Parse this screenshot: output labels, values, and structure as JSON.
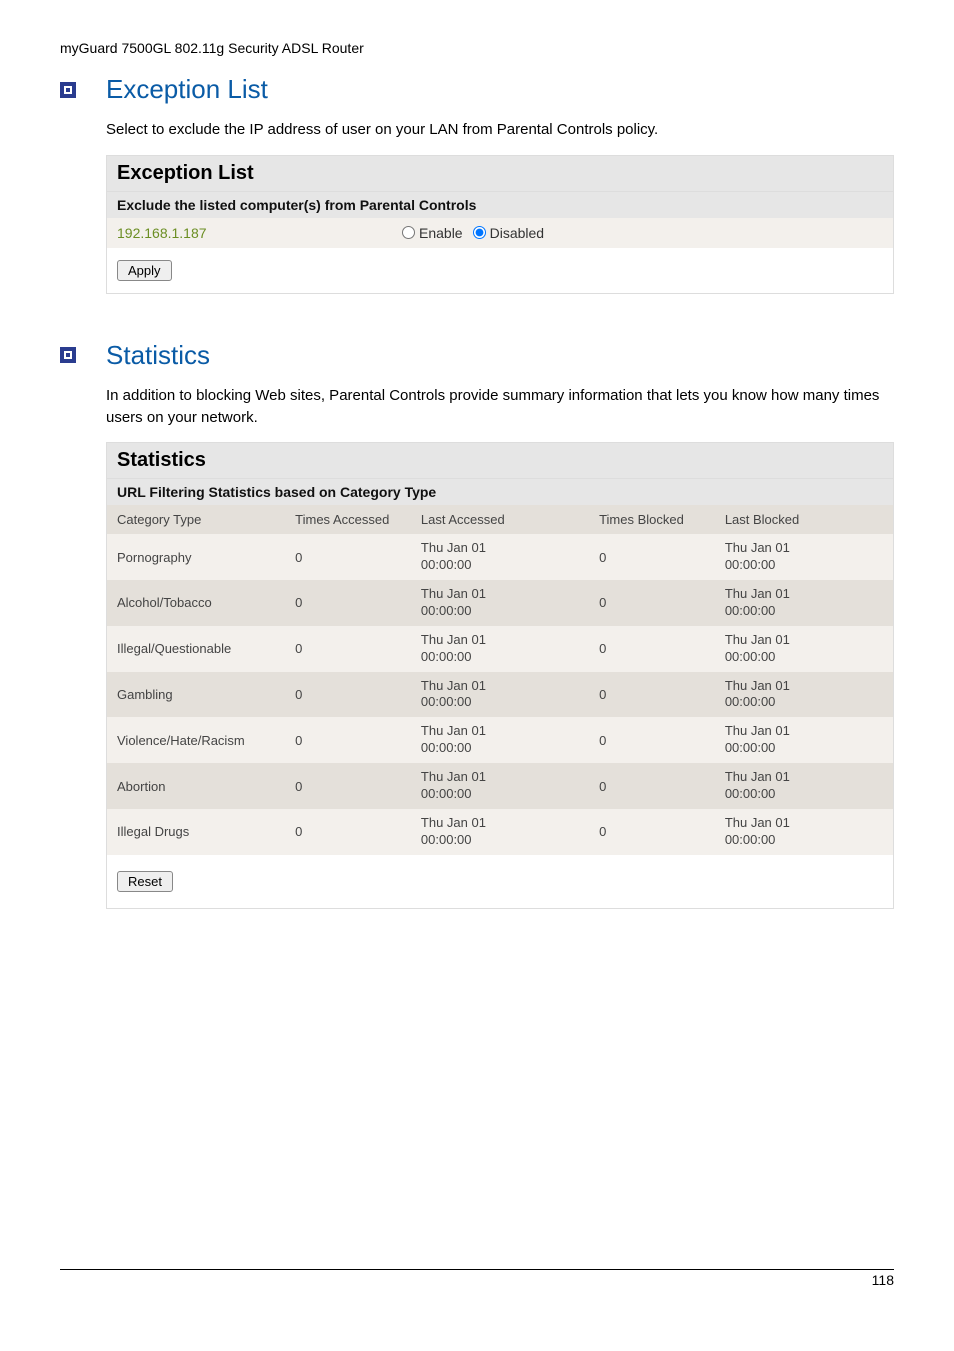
{
  "header": "myGuard 7500GL 802.11g Security ADSL Router",
  "exception": {
    "title": "Exception List",
    "description": "Select                 to exclude the IP address of user on your LAN from Parental Controls policy.",
    "panel_title": "Exception List",
    "panel_subtitle": "Exclude the listed computer(s) from Parental Controls",
    "ip": "192.168.1.187",
    "radio_enable": "Enable",
    "radio_disabled": "Disabled",
    "apply_label": "Apply"
  },
  "statistics": {
    "title": "Statistics",
    "description": "In addition to blocking Web sites, Parental Controls provide summary information that lets you know how many times users on your network.",
    "panel_title": "Statistics",
    "panel_subtitle": "URL Filtering Statistics based on Category Type",
    "headers": {
      "category": "Category Type",
      "times_accessed": "Times Accessed",
      "last_accessed": "Last Accessed",
      "times_blocked": "Times Blocked",
      "last_blocked": "Last Blocked"
    },
    "rows": [
      {
        "cat": "Pornography",
        "ta": "0",
        "la": "Thu Jan 01 00:00:00",
        "tb": "0",
        "lb": "Thu Jan 01 00:00:00"
      },
      {
        "cat": "Alcohol/Tobacco",
        "ta": "0",
        "la": "Thu Jan 01 00:00:00",
        "tb": "0",
        "lb": "Thu Jan 01 00:00:00"
      },
      {
        "cat": "Illegal/Questionable",
        "ta": "0",
        "la": "Thu Jan 01 00:00:00",
        "tb": "0",
        "lb": "Thu Jan 01 00:00:00"
      },
      {
        "cat": "Gambling",
        "ta": "0",
        "la": "Thu Jan 01 00:00:00",
        "tb": "0",
        "lb": "Thu Jan 01 00:00:00"
      },
      {
        "cat": "Violence/Hate/Racism",
        "ta": "0",
        "la": "Thu Jan 01 00:00:00",
        "tb": "0",
        "lb": "Thu Jan 01 00:00:00"
      },
      {
        "cat": "Abortion",
        "ta": "0",
        "la": "Thu Jan 01 00:00:00",
        "tb": "0",
        "lb": "Thu Jan 01 00:00:00"
      },
      {
        "cat": "Illegal Drugs",
        "ta": "0",
        "la": "Thu Jan 01 00:00:00",
        "tb": "0",
        "lb": "Thu Jan 01 00:00:00"
      }
    ],
    "reset_label": "Reset"
  },
  "page_number": "118"
}
